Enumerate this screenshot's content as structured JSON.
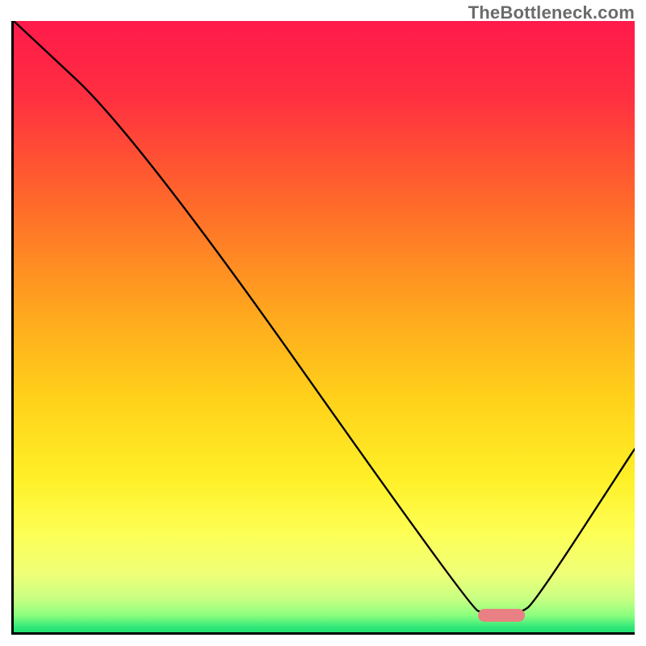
{
  "watermark": "TheBottleneck.com",
  "colors": {
    "gradient_stops": [
      {
        "offset": 0.0,
        "color": "#ff1a4b"
      },
      {
        "offset": 0.12,
        "color": "#ff2e41"
      },
      {
        "offset": 0.3,
        "color": "#ff6a2a"
      },
      {
        "offset": 0.48,
        "color": "#ffa81e"
      },
      {
        "offset": 0.62,
        "color": "#ffd21a"
      },
      {
        "offset": 0.75,
        "color": "#fff028"
      },
      {
        "offset": 0.84,
        "color": "#fdff56"
      },
      {
        "offset": 0.905,
        "color": "#eeff78"
      },
      {
        "offset": 0.945,
        "color": "#c8ff82"
      },
      {
        "offset": 0.972,
        "color": "#8dff7f"
      },
      {
        "offset": 0.992,
        "color": "#2fe879"
      },
      {
        "offset": 1.0,
        "color": "#22e06f"
      }
    ],
    "marker": "#e98083",
    "curve": "#000000"
  },
  "marker_position": {
    "x_frac": 0.785,
    "y_frac": 0.972
  },
  "chart_data": {
    "type": "line",
    "title": "",
    "xlabel": "",
    "ylabel": "",
    "xlim": [
      0,
      1
    ],
    "ylim": [
      0,
      1
    ],
    "series": [
      {
        "name": "bottleneck_curve",
        "points": [
          {
            "x": 0.0,
            "y": 1.0
          },
          {
            "x": 0.2,
            "y": 0.81
          },
          {
            "x": 0.735,
            "y": 0.04
          },
          {
            "x": 0.76,
            "y": 0.03
          },
          {
            "x": 0.815,
            "y": 0.03
          },
          {
            "x": 0.84,
            "y": 0.05
          },
          {
            "x": 1.0,
            "y": 0.3
          }
        ]
      }
    ],
    "annotations": [
      {
        "type": "pill_marker",
        "x": 0.785,
        "y": 0.028,
        "color": "#e98083"
      }
    ]
  }
}
